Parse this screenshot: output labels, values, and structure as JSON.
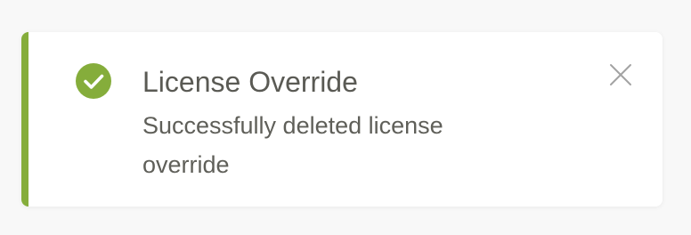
{
  "toast": {
    "title": "License Override",
    "message": "Successfully deleted license override",
    "status_icon": "check-circle-icon",
    "close_icon": "close-icon",
    "accent_color": "#85ad3b"
  }
}
